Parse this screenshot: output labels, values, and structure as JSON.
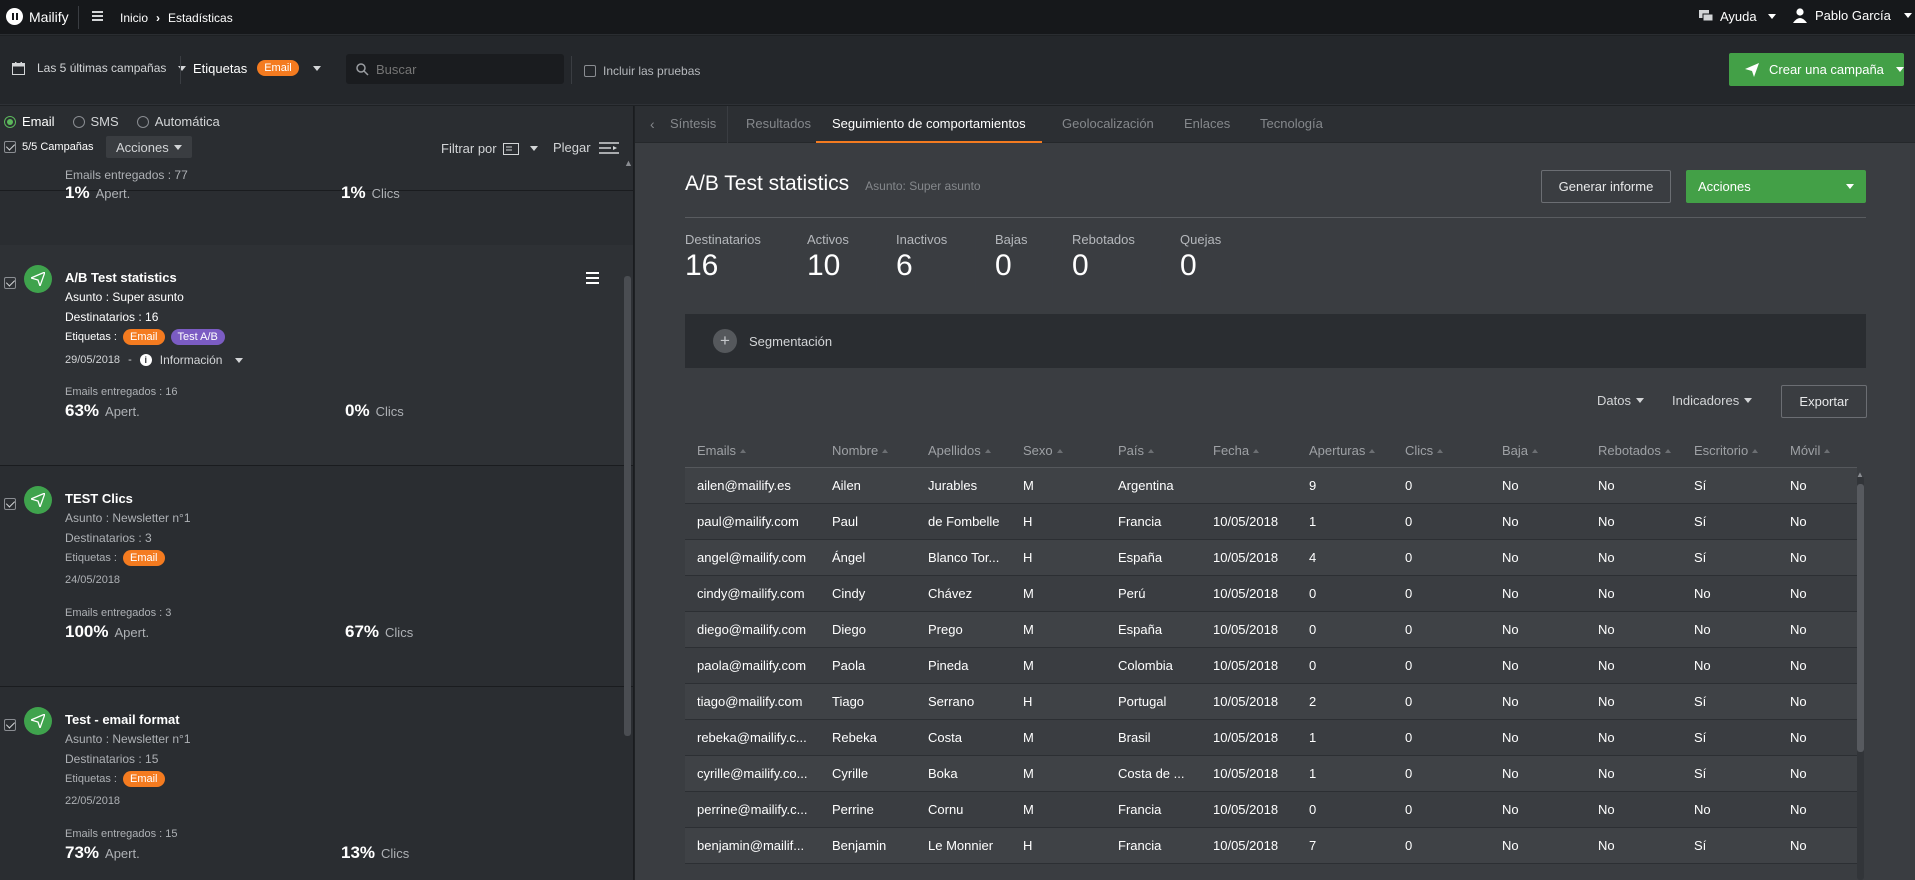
{
  "app": {
    "logo": "Mailify"
  },
  "breadcrumb": {
    "home": "Inicio",
    "current": "Estadísticas"
  },
  "header": {
    "help": "Ayuda",
    "user": "Pablo García"
  },
  "filters": {
    "campaigns_select": "Las 5 últimas campañas",
    "tags_label": "Etiquetas",
    "tag": "Email",
    "search_placeholder": "Buscar",
    "include_tests": "Incluir las pruebas",
    "create_button": "Crear una campaña"
  },
  "left": {
    "types": [
      "Email",
      "SMS",
      "Automática"
    ],
    "count": "5/5 Campañas",
    "actions": "Acciones",
    "filter_by": "Filtrar por",
    "fold": "Plegar"
  },
  "campaigns": [
    {
      "delivered": "Emails entregados : 77",
      "open_pct": "1%",
      "open_lbl": "Apert.",
      "click_pct": "1%",
      "click_lbl": "Clics"
    },
    {
      "title": "A/B Test statistics",
      "subject": "Asunto : Super asunto",
      "recipients": "Destinatarios : 16",
      "tags_lbl": "Etiquetas :",
      "tags": [
        "Email",
        "Test A/B"
      ],
      "date": "29/05/2018",
      "info": "Información",
      "delivered": "Emails entregados : 16",
      "open_pct": "63%",
      "open_lbl": "Apert.",
      "click_pct": "0%",
      "click_lbl": "Clics"
    },
    {
      "title": "TEST Clics",
      "subject": "Asunto : Newsletter n°1",
      "recipients": "Destinatarios : 3",
      "tags_lbl": "Etiquetas :",
      "tags": [
        "Email"
      ],
      "date": "24/05/2018",
      "delivered": "Emails entregados : 3",
      "open_pct": "100%",
      "open_lbl": "Apert.",
      "click_pct": "67%",
      "click_lbl": "Clics"
    },
    {
      "title": "Test - email format",
      "subject": "Asunto : Newsletter n°1",
      "recipients": "Destinatarios : 15",
      "tags_lbl": "Etiquetas :",
      "tags": [
        "Email"
      ],
      "date": "22/05/2018",
      "delivered": "Emails entregados : 15",
      "open_pct": "73%",
      "open_lbl": "Apert.",
      "click_pct": "13%",
      "click_lbl": "Clics"
    }
  ],
  "tabs": [
    "Síntesis",
    "Resultados",
    "Seguimiento de comportamientos",
    "Geolocalización",
    "Enlaces",
    "Tecnología"
  ],
  "detail": {
    "title": "A/B Test statistics",
    "subject": "Asunto: Super asunto",
    "report_button": "Generar informe",
    "actions_button": "Acciones",
    "stats": [
      {
        "label": "Destinatarios",
        "value": "16"
      },
      {
        "label": "Activos",
        "value": "10"
      },
      {
        "label": "Inactivos",
        "value": "6"
      },
      {
        "label": "Bajas",
        "value": "0"
      },
      {
        "label": "Rebotados",
        "value": "0"
      },
      {
        "label": "Quejas",
        "value": "0"
      }
    ],
    "segmentation": "Segmentación",
    "data_dd": "Datos",
    "indicators_dd": "Indicadores",
    "export_button": "Exportar"
  },
  "table": {
    "columns": [
      "Emails",
      "Nombre",
      "Apellidos",
      "Sexo",
      "País",
      "Fecha",
      "Aperturas",
      "Clics",
      "Baja",
      "Rebotados",
      "Escritorio",
      "Móvil"
    ],
    "rows": [
      [
        "ailen@mailify.es",
        "Ailen",
        "Jurables",
        "M",
        "Argentina",
        "",
        "9",
        "0",
        "No",
        "No",
        "Sí",
        "No"
      ],
      [
        "paul@mailify.com",
        "Paul",
        "de Fombelle",
        "H",
        "Francia",
        "10/05/2018",
        "1",
        "0",
        "No",
        "No",
        "Sí",
        "No"
      ],
      [
        "angel@mailify.com",
        "Ángel",
        "Blanco Tor...",
        "H",
        "España",
        "10/05/2018",
        "4",
        "0",
        "No",
        "No",
        "Sí",
        "No"
      ],
      [
        "cindy@mailify.com",
        "Cindy",
        "Chávez",
        "M",
        "Perú",
        "10/05/2018",
        "0",
        "0",
        "No",
        "No",
        "No",
        "No"
      ],
      [
        "diego@mailify.com",
        "Diego",
        "Prego",
        "M",
        "España",
        "10/05/2018",
        "0",
        "0",
        "No",
        "No",
        "No",
        "No"
      ],
      [
        "paola@mailify.com",
        "Paola",
        "Pineda",
        "M",
        "Colombia",
        "10/05/2018",
        "0",
        "0",
        "No",
        "No",
        "No",
        "No"
      ],
      [
        "tiago@mailify.com",
        "Tiago",
        "Serrano",
        "H",
        "Portugal",
        "10/05/2018",
        "2",
        "0",
        "No",
        "No",
        "Sí",
        "No"
      ],
      [
        "rebeka@mailify.c...",
        "Rebeka",
        "Costa",
        "M",
        "Brasil",
        "10/05/2018",
        "1",
        "0",
        "No",
        "No",
        "Sí",
        "No"
      ],
      [
        "cyrille@mailify.co...",
        "Cyrille",
        "Boka",
        "M",
        "Costa de ...",
        "10/05/2018",
        "1",
        "0",
        "No",
        "No",
        "Sí",
        "No"
      ],
      [
        "perrine@mailify.c...",
        "Perrine",
        "Cornu",
        "M",
        "Francia",
        "10/05/2018",
        "0",
        "0",
        "No",
        "No",
        "No",
        "No"
      ],
      [
        "benjamin@mailif...",
        "Benjamin",
        "Le Monnier",
        "H",
        "Francia",
        "10/05/2018",
        "7",
        "0",
        "No",
        "No",
        "Sí",
        "No"
      ]
    ]
  }
}
